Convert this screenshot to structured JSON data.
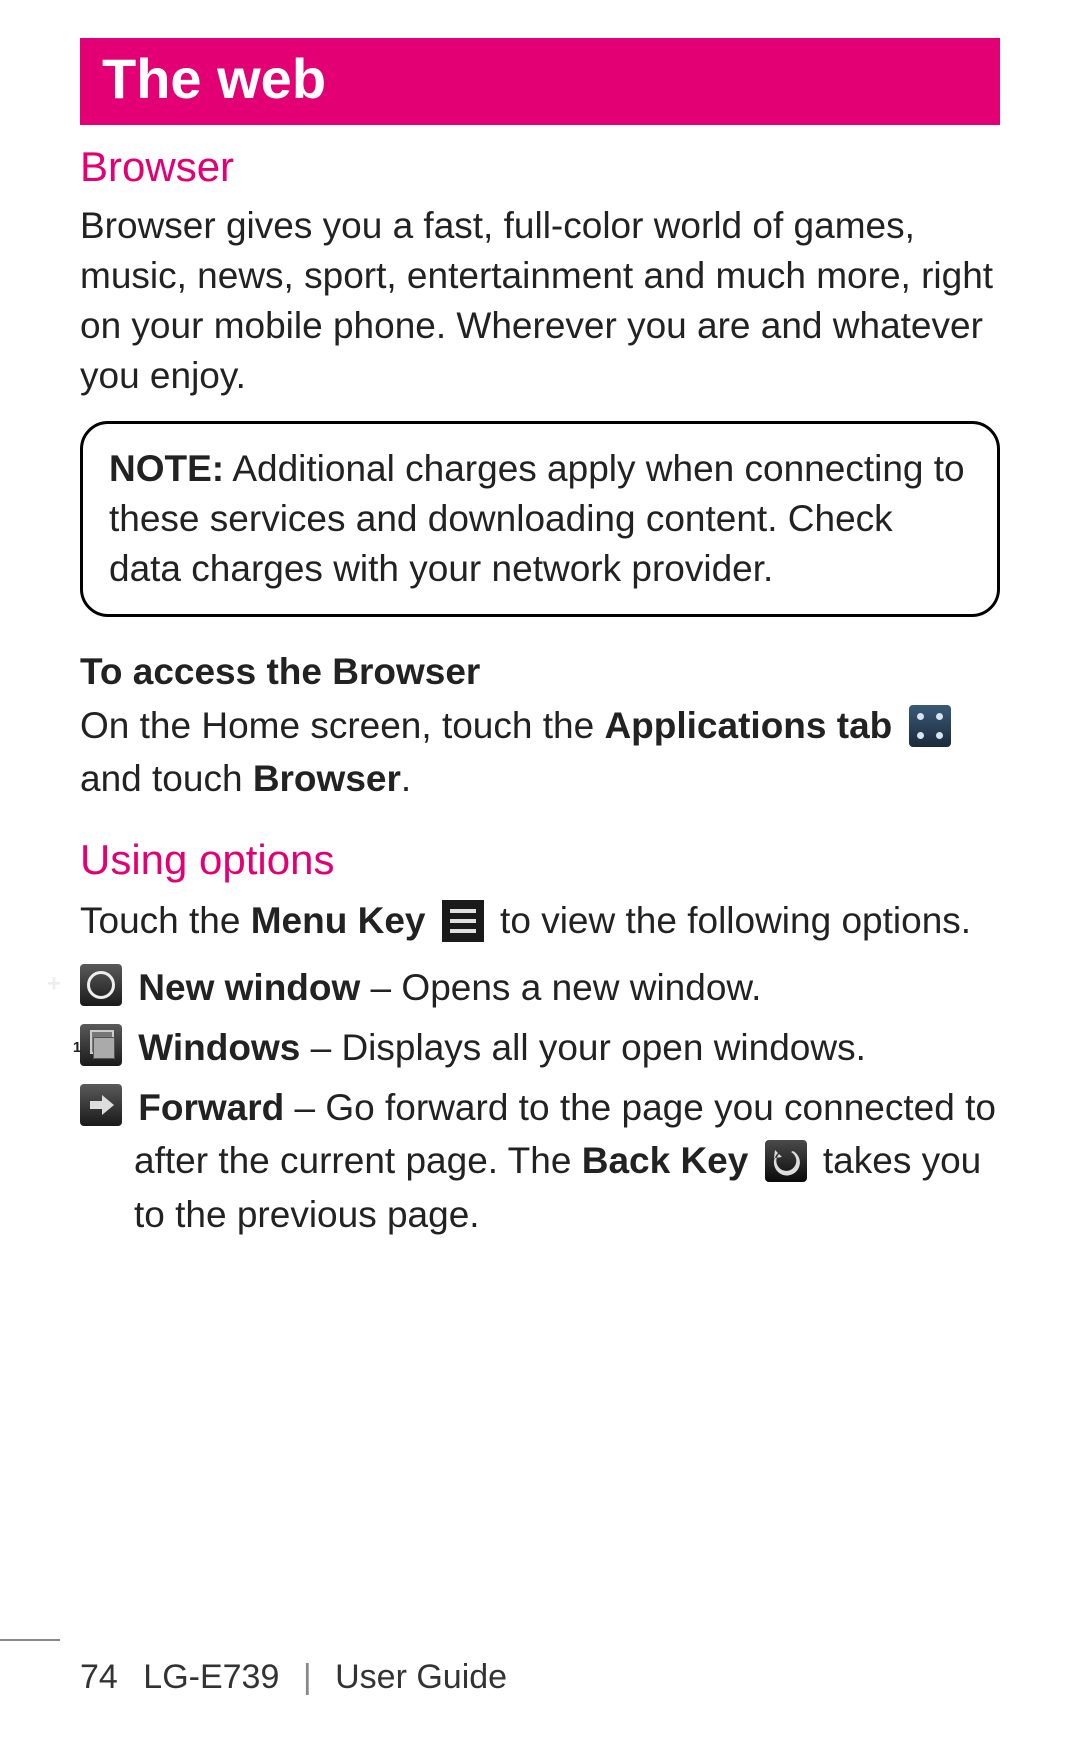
{
  "chapter_title": "The web",
  "section1": {
    "heading": "Browser",
    "body": "Browser gives you a fast, full-color world of games, music, news, sport, entertainment and much more, right on your mobile phone. Wherever you are and whatever you enjoy."
  },
  "note": {
    "label": "NOTE:",
    "text": " Additional charges apply when connecting to these services and downloading content. Check data charges with your network provider."
  },
  "access": {
    "heading": "To access the Browser",
    "line_before": "On the Home screen, touch the ",
    "apps_tab": "Applications tab",
    "line_after": " and touch ",
    "browser_label": "Browser",
    "period": "."
  },
  "options": {
    "heading": "Using options",
    "intro_before": "Touch the ",
    "menu_key": "Menu Key",
    "intro_after": " to view the following options.",
    "items": [
      {
        "name": "New window",
        "desc": " – Opens a new window."
      },
      {
        "name": "Windows",
        "desc": " – Displays all your open windows."
      },
      {
        "name": "Forward",
        "desc_before": " – Go forward to the page you connected to after the current page. The ",
        "back_key": "Back Key",
        "desc_after": " takes you to the previous page."
      }
    ]
  },
  "footer": {
    "page": "74",
    "model": "LG-E739",
    "guide": "User Guide"
  }
}
